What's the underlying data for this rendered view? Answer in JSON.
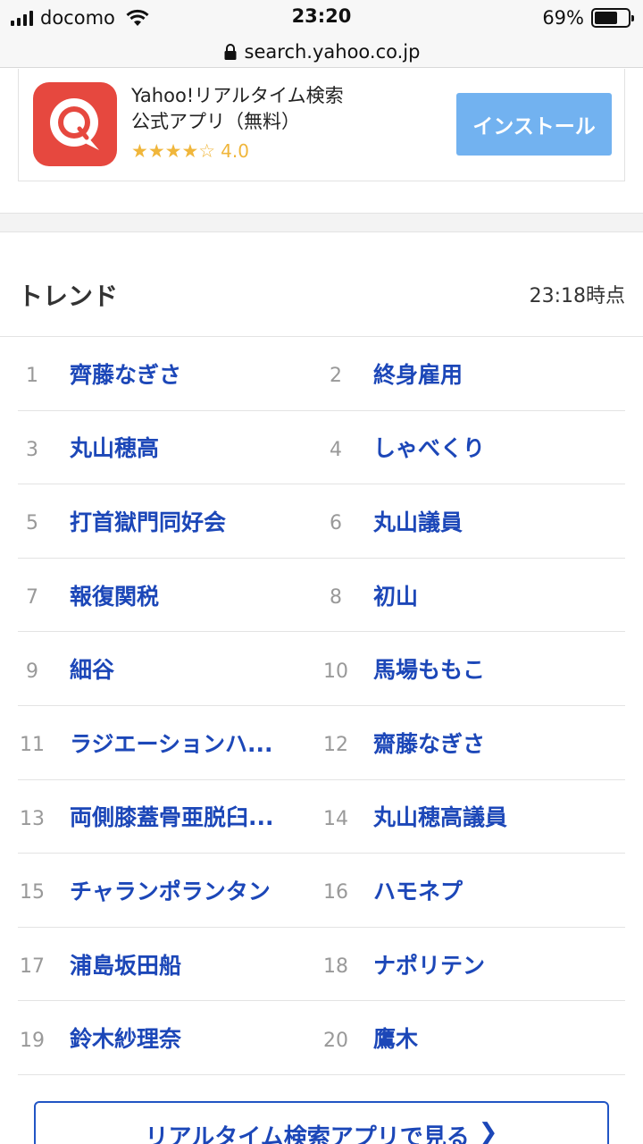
{
  "status_bar": {
    "carrier": "docomo",
    "time": "23:20",
    "battery_percent": "69%",
    "battery_level": 0.69
  },
  "url_bar": {
    "url": "search.yahoo.co.jp"
  },
  "app_banner": {
    "title_line1": "Yahoo!リアルタイム検索",
    "title_line2": "公式アプリ（無料）",
    "stars": "★★★★☆",
    "rating": "4.0",
    "install_label": "インストール",
    "icon_color": "#e6483f"
  },
  "trend": {
    "title": "トレンド",
    "timestamp": "23:18時点",
    "rows": [
      [
        {
          "rank": "1",
          "term": "齊藤なぎさ"
        },
        {
          "rank": "2",
          "term": "終身雇用"
        }
      ],
      [
        {
          "rank": "3",
          "term": "丸山穂高"
        },
        {
          "rank": "4",
          "term": "しゃべくり"
        }
      ],
      [
        {
          "rank": "5",
          "term": "打首獄門同好会"
        },
        {
          "rank": "6",
          "term": "丸山議員"
        }
      ],
      [
        {
          "rank": "7",
          "term": "報復関税"
        },
        {
          "rank": "8",
          "term": "初山"
        }
      ],
      [
        {
          "rank": "9",
          "term": "細谷"
        },
        {
          "rank": "10",
          "term": "馬場ももこ"
        }
      ],
      [
        {
          "rank": "11",
          "term": "ラジエーションハ..."
        },
        {
          "rank": "12",
          "term": "齋藤なぎさ"
        }
      ],
      [
        {
          "rank": "13",
          "term": "両側膝蓋骨亜脱臼..."
        },
        {
          "rank": "14",
          "term": "丸山穂高議員"
        }
      ],
      [
        {
          "rank": "15",
          "term": "チャランポランタン"
        },
        {
          "rank": "16",
          "term": "ハモネプ"
        }
      ],
      [
        {
          "rank": "17",
          "term": "浦島坂田船"
        },
        {
          "rank": "18",
          "term": "ナポリテン"
        }
      ],
      [
        {
          "rank": "19",
          "term": "鈴木紗理奈"
        },
        {
          "rank": "20",
          "term": "鷹木"
        }
      ]
    ]
  },
  "footer": {
    "app_link_label": "リアルタイム検索アプリで見る",
    "chevron": "❯"
  },
  "colors": {
    "link_blue": "#1c47b8",
    "install_blue": "#72b2f0",
    "star_gold": "#f0b63b"
  }
}
